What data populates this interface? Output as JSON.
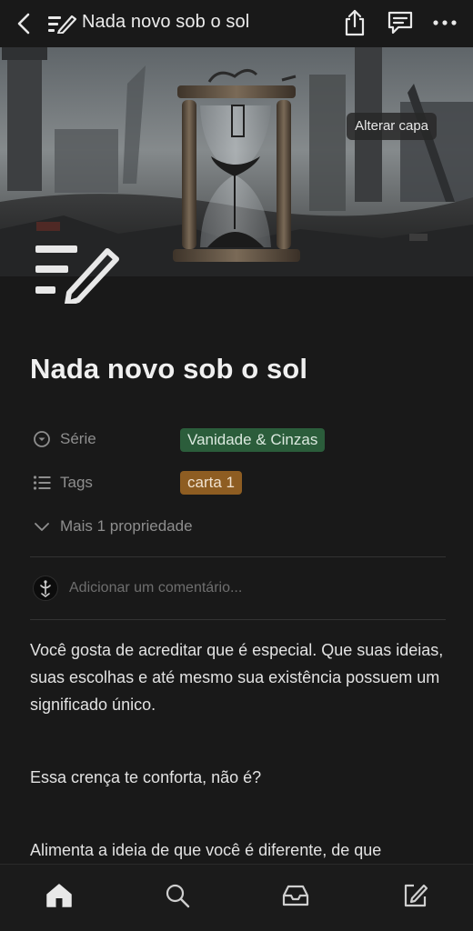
{
  "topbar": {
    "title": "Nada novo sob o sol",
    "back_icon": "chevron-left-icon",
    "page_icon": "write-lines-icon",
    "share_icon": "share-icon",
    "comments_icon": "comments-icon",
    "more_icon": "more-dots-icon"
  },
  "cover": {
    "change_cover_label": "Alterar capa"
  },
  "page": {
    "title": "Nada novo sob o sol",
    "properties": [
      {
        "icon": "select-icon",
        "label": "Série",
        "value": "Vanidade & Cinzas",
        "color": "#2b5d3b"
      },
      {
        "icon": "list-icon",
        "label": "Tags",
        "value": "carta 1",
        "color": "#8e5d22"
      }
    ],
    "more_properties_label": "Mais 1 propriedade",
    "comment_placeholder": "Adicionar um comentário...",
    "paragraphs": [
      "Você gosta de acreditar que é especial. Que suas ideias, suas escolhas e até mesmo sua existência possuem um significado único.",
      "Essa crença te conforta, não é?",
      "Alimenta a ideia de que você é diferente, de que"
    ]
  },
  "bottomnav": {
    "items": [
      "home-icon",
      "search-icon",
      "inbox-icon",
      "compose-icon"
    ]
  },
  "colors": {
    "background": "#191919",
    "text": "#e6e6e6",
    "muted": "#8e8e8e"
  }
}
